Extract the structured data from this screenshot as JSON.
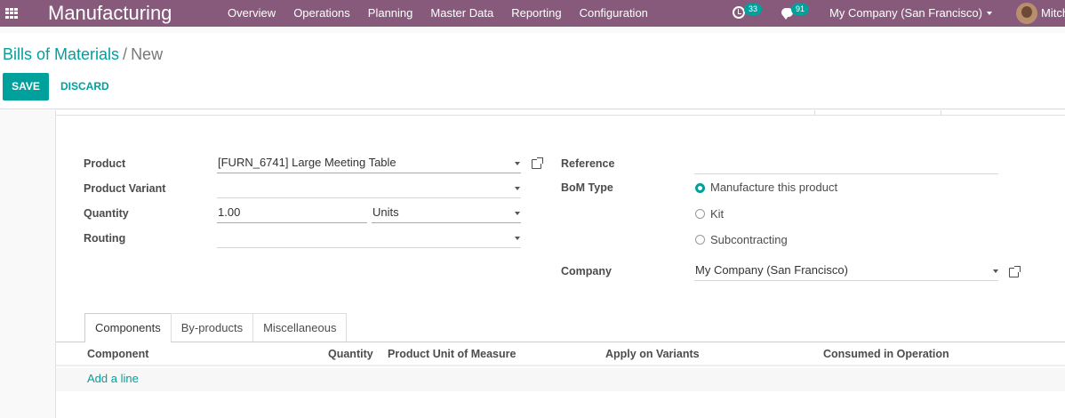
{
  "navbar": {
    "app_name": "Manufacturing",
    "menu": [
      "Overview",
      "Operations",
      "Planning",
      "Master Data",
      "Reporting",
      "Configuration"
    ],
    "activity_count": "33",
    "message_count": "91",
    "company": "My Company (San Francisco)",
    "user": "Mitch"
  },
  "breadcrumb": {
    "parent": "Bills of Materials",
    "separator": "/",
    "current": "New"
  },
  "buttons": {
    "save": "SAVE",
    "discard": "DISCARD"
  },
  "form": {
    "product_label": "Product",
    "product_value": "[FURN_6741] Large Meeting Table",
    "variant_label": "Product Variant",
    "variant_value": "",
    "quantity_label": "Quantity",
    "quantity_value": "1.00",
    "uom_value": "Units",
    "routing_label": "Routing",
    "routing_value": "",
    "reference_label": "Reference",
    "reference_value": "",
    "bom_type_label": "BoM Type",
    "bom_type_options": [
      "Manufacture this product",
      "Kit",
      "Subcontracting"
    ],
    "bom_type_selected": "Manufacture this product",
    "company_label": "Company",
    "company_value": "My Company (San Francisco)"
  },
  "tabs": [
    "Components",
    "By-products",
    "Miscellaneous"
  ],
  "active_tab": "Components",
  "components_table": {
    "columns": [
      "Component",
      "Quantity",
      "Product Unit of Measure",
      "Apply on Variants",
      "Consumed in Operation"
    ],
    "add_line": "Add a line"
  },
  "colors": {
    "navbar": "#875a7b",
    "accent": "#00a09d"
  }
}
